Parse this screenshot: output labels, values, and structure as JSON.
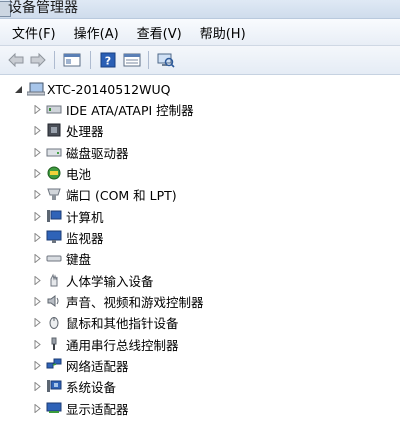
{
  "window": {
    "title": "设备管理器"
  },
  "menu": [
    "文件(F)",
    "操作(A)",
    "查看(V)",
    "帮助(H)"
  ],
  "toolbar": {
    "buttons": [
      "back-icon",
      "forward-icon",
      "properties-pane-icon",
      "help-icon",
      "list-view-icon",
      "scan-hardware-icon"
    ]
  },
  "tree": {
    "root": "XTC-20140512WUQ",
    "items": [
      {
        "label": "IDE ATA/ATAPI 控制器",
        "icon": "ide-controller-icon"
      },
      {
        "label": "处理器",
        "icon": "processor-icon"
      },
      {
        "label": "磁盘驱动器",
        "icon": "disk-drive-icon"
      },
      {
        "label": "电池",
        "icon": "battery-icon"
      },
      {
        "label": "端口 (COM 和 LPT)",
        "icon": "port-icon"
      },
      {
        "label": "计算机",
        "icon": "computer-icon"
      },
      {
        "label": "监视器",
        "icon": "monitor-icon"
      },
      {
        "label": "键盘",
        "icon": "keyboard-icon"
      },
      {
        "label": "人体学输入设备",
        "icon": "hid-icon"
      },
      {
        "label": "声音、视频和游戏控制器",
        "icon": "sound-icon"
      },
      {
        "label": "鼠标和其他指针设备",
        "icon": "mouse-icon"
      },
      {
        "label": "通用串行总线控制器",
        "icon": "usb-icon"
      },
      {
        "label": "网络适配器",
        "icon": "network-icon"
      },
      {
        "label": "系统设备",
        "icon": "system-device-icon"
      },
      {
        "label": "显示适配器",
        "icon": "display-adapter-icon"
      }
    ]
  }
}
